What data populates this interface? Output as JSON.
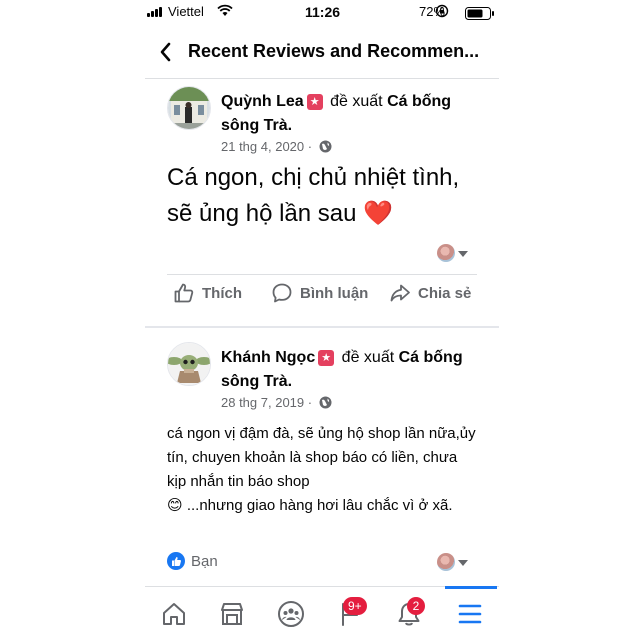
{
  "status_bar": {
    "carrier": "Viettel",
    "time": "11:26",
    "battery_pct": "72%"
  },
  "header": {
    "title": "Recent Reviews and Recommen..."
  },
  "posts": [
    {
      "author": "Quỳnh Lea",
      "recommends": "đề xuất",
      "page": "Cá bống sông Trà.",
      "date": "21 thg 4, 2020",
      "text": "Cá ngon, chị chủ nhiệt tình, sẽ ủng hộ lần sau",
      "emoji": "❤️"
    },
    {
      "author": "Khánh Ngọc",
      "recommends": "đề xuất",
      "page": "Cá bống sông Trà.",
      "date": "28 thg 7, 2019",
      "text": "cá ngon vị đậm đà, sẽ ủng hộ shop lần nữa,ủy tín, chuyen khoản là shop báo có liền, chưa kịp nhắn tin báo shop",
      "text2": "...nhưng giao hàng hơi lâu chắc vì ở xã.",
      "emoji": "😊",
      "reaction_label": "Bạn"
    }
  ],
  "actions": {
    "like": "Thích",
    "comment": "Bình luận",
    "share": "Chia sẻ"
  },
  "tabbar": {
    "items": [
      "home-icon",
      "marketplace-icon",
      "groups-icon",
      "pages-icon",
      "notifications-icon",
      "menu-icon"
    ],
    "pages_badge": "9+",
    "notifications_badge": "2",
    "active": "menu-icon",
    "accent": "#1877f2",
    "badge_color": "#e41e3f"
  }
}
